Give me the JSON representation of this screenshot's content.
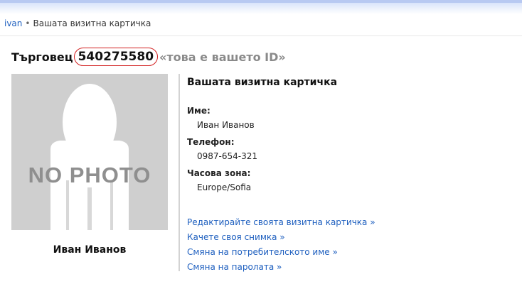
{
  "breadcrumb": {
    "user_link": "ivan",
    "separator": "•",
    "current": "Вашата визитна картичка"
  },
  "heading": {
    "label": "Търговец",
    "merchant_id": "540275580",
    "id_note": "«това е вашето ID»"
  },
  "photo": {
    "placeholder_text": "NO PHOTO"
  },
  "owner_name": "Иван Иванов",
  "card": {
    "title": "Вашата визитна картичка",
    "fields": [
      {
        "label": "Име:",
        "value": "Иван Иванов"
      },
      {
        "label": "Телефон:",
        "value": "0987-654-321"
      },
      {
        "label": "Часова зона:",
        "value": "Europe/Sofia"
      }
    ]
  },
  "links": [
    "Редактирайте своята визитна картичка »",
    "Качете своя снимка »",
    "Смяна на потребителското име »",
    "Смяна на паролата »"
  ],
  "colors": {
    "link": "#1e5fbf",
    "id_highlight": "#d21f1f",
    "photo_bg": "#cfcfcf"
  }
}
